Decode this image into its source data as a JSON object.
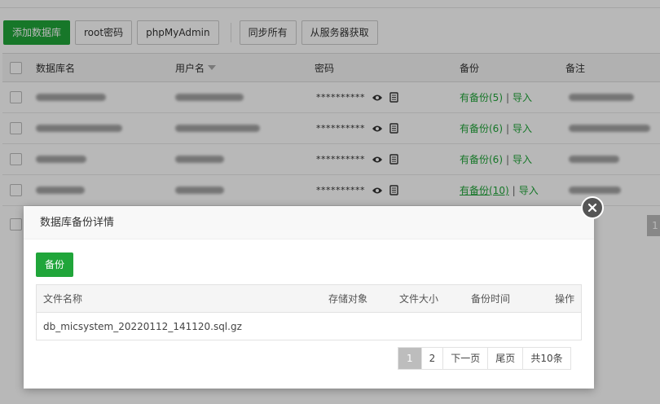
{
  "toolbar": {
    "add_db": "添加数据库",
    "root_pwd": "root密码",
    "phpmyadmin": "phpMyAdmin",
    "sync_all": "同步所有",
    "fetch_from_server": "从服务器获取"
  },
  "table": {
    "columns": {
      "db_name": "数据库名",
      "username": "用户名",
      "password": "密码",
      "backup": "备份",
      "note": "备注"
    },
    "rows": [
      {
        "password": "**********",
        "backup_text": "有备份(5)",
        "import": "导入"
      },
      {
        "password": "**********",
        "backup_text": "有备份(6)",
        "import": "导入"
      },
      {
        "password": "**********",
        "backup_text": "有备份(6)",
        "import": "导入"
      },
      {
        "password": "**********",
        "backup_text": "有备份(10)",
        "import": "导入"
      }
    ],
    "bottom_page": "1"
  },
  "modal": {
    "title": "数据库备份详情",
    "backup_button": "备份",
    "columns": {
      "file_name": "文件名称",
      "storage": "存储对象",
      "size": "文件大小",
      "time": "备份时间",
      "action": "操作"
    },
    "rows": [
      {
        "file_name": "db_micsystem_20220112_141120.sql.gz"
      }
    ],
    "pager": {
      "page1": "1",
      "page2": "2",
      "next": "下一页",
      "last": "尾页",
      "total": "共10条"
    }
  },
  "colors": {
    "accent": "#20a53a",
    "overlay": "rgba(0,0,0,0.28)"
  }
}
